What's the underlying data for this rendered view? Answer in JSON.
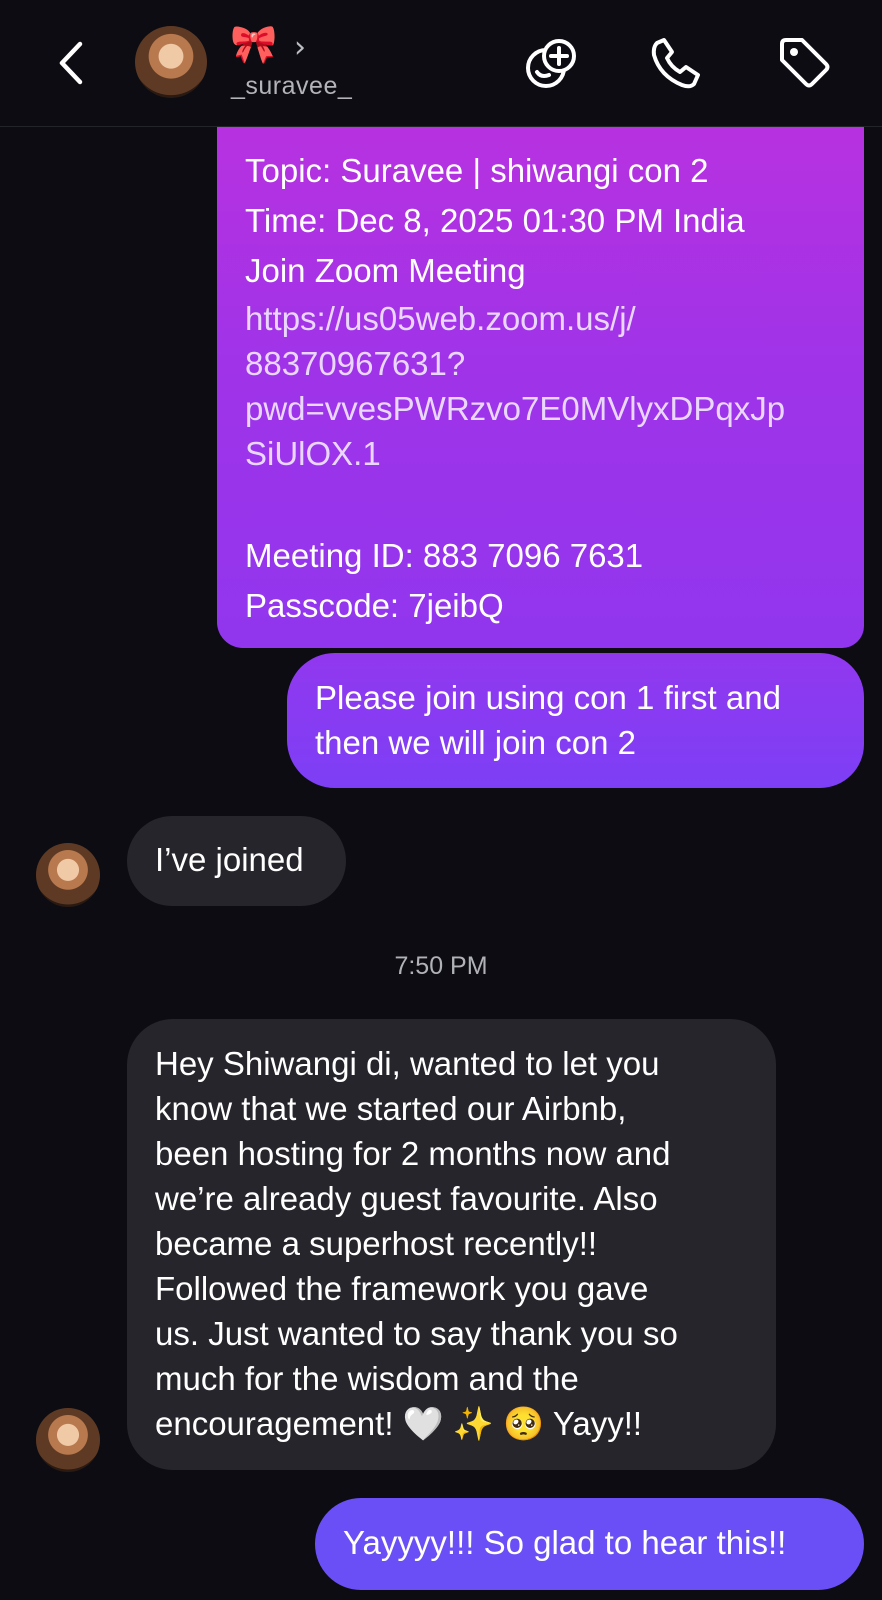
{
  "header": {
    "bow_emoji": "🎀",
    "chevron": "›",
    "username": "_suravee_"
  },
  "messages": {
    "sent_zoom": {
      "topic": "Topic: Suravee | shiwangi con 2",
      "time": "Time: Dec 8, 2025 01:30 PM India",
      "join": "Join Zoom Meeting",
      "link_lines": [
        "https://us05web.zoom.us/j/",
        "88370967631?",
        "pwd=vvesPWRzvo7E0MVlyxDPqxJp",
        "SiUlOX.1"
      ],
      "meeting_id": "Meeting ID: 883 7096 7631",
      "passcode": "Passcode: 7jeibQ"
    },
    "sent_con": "Please join using con 1 first and then we will join con 2",
    "recv_joined": "I’ve joined",
    "timestamp": "7:50 PM",
    "recv_long_lines": [
      "Hey Shiwangi di, wanted to let you",
      "know that we started our Airbnb,",
      "been hosting for 2 months now and",
      "we’re already guest favourite. Also",
      "became a superhost recently!!",
      "Followed the framework you gave",
      "us. Just wanted to say thank you so",
      "much for the wisdom and the",
      "encouragement! 🤍 ✨ 🥺  Yayy!!"
    ],
    "sent_reply": "Yayyyy!!! So glad to hear this!!"
  },
  "colors": {
    "background": "#0c0c12",
    "received_bubble": "#25252b",
    "sent_gradient_top": "#b732e0",
    "sent_final": "#6b4ff6"
  }
}
